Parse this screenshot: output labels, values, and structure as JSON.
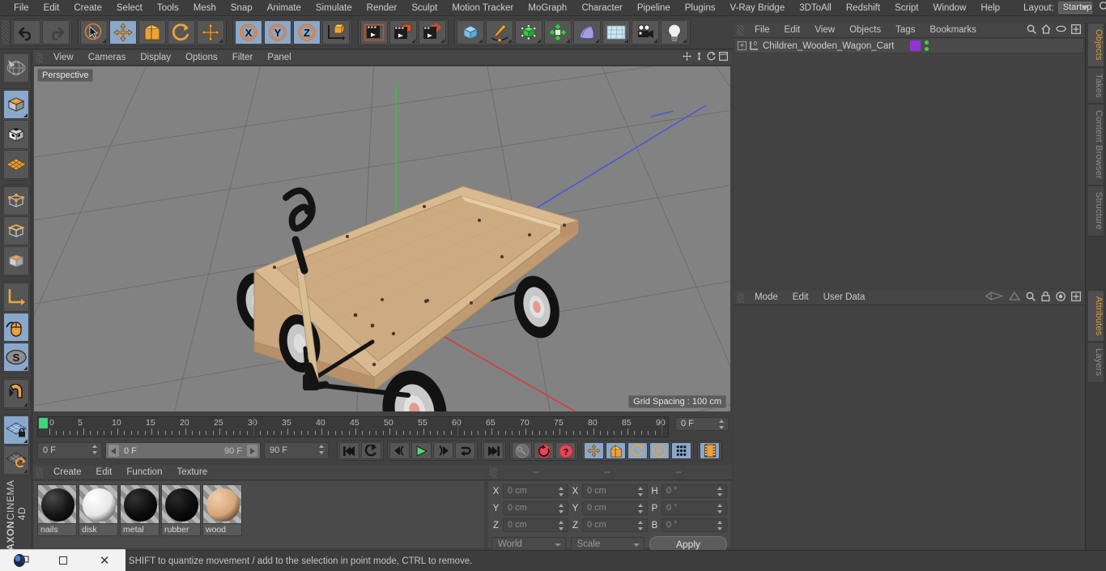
{
  "menubar": {
    "items": [
      "File",
      "Edit",
      "Create",
      "Select",
      "Tools",
      "Mesh",
      "Snap",
      "Animate",
      "Simulate",
      "Render",
      "Sculpt",
      "Motion Tracker",
      "MoGraph",
      "Character",
      "Pipeline",
      "Plugins",
      "V-Ray Bridge",
      "3DToAll",
      "Redshift",
      "Script",
      "Window",
      "Help"
    ],
    "layout_label": "Layout:",
    "layout_value": "Startup",
    "search_icon": "search-icon"
  },
  "toolbar": {
    "groups": [
      {
        "name": "undo-redo",
        "buttons": [
          {
            "name": "undo-button",
            "icon": "undo-arrow-icon",
            "active": false,
            "corner": false
          },
          {
            "name": "redo-button",
            "icon": "redo-arrow-icon",
            "active": false,
            "corner": false
          }
        ]
      },
      {
        "name": "transform-tools",
        "buttons": [
          {
            "name": "live-selection-tool",
            "icon": "cursor-circle-icon",
            "active": false,
            "corner": true
          },
          {
            "name": "move-tool",
            "icon": "move-arrows-icon",
            "active": true,
            "corner": false
          },
          {
            "name": "scale-tool",
            "icon": "scale-box-icon",
            "active": false,
            "corner": false
          },
          {
            "name": "rotate-tool",
            "icon": "rotate-circle-icon",
            "active": false,
            "corner": false
          },
          {
            "name": "dynamic-place-tool",
            "icon": "move-arrows-icon",
            "active": false,
            "corner": true
          }
        ]
      },
      {
        "name": "axis-locks",
        "buttons": [
          {
            "name": "lock-x-axis-button",
            "icon": "x-axis-icon",
            "active": true,
            "corner": false
          },
          {
            "name": "lock-y-axis-button",
            "icon": "y-axis-icon",
            "active": true,
            "corner": false
          },
          {
            "name": "lock-z-axis-button",
            "icon": "z-axis-icon",
            "active": true,
            "corner": false
          },
          {
            "name": "world-object-coord-button",
            "icon": "world-axis-cube-icon",
            "active": false,
            "corner": false
          }
        ]
      },
      {
        "name": "render-tools",
        "buttons": [
          {
            "name": "render-view-button",
            "icon": "clapperboard-icon",
            "active": false,
            "corner": false
          },
          {
            "name": "render-to-picture-viewer-button",
            "icon": "clapperboard-window-icon",
            "active": false,
            "corner": true
          },
          {
            "name": "render-settings-button",
            "icon": "clapperboard-gear-icon",
            "active": false,
            "corner": true
          }
        ]
      },
      {
        "name": "create-objects",
        "buttons": [
          {
            "name": "add-cube-button",
            "icon": "blue-cube-icon",
            "active": false,
            "corner": true
          },
          {
            "name": "add-spline-button",
            "icon": "pen-spline-icon",
            "active": false,
            "corner": true
          },
          {
            "name": "add-generator-button",
            "icon": "green-cube-icon",
            "active": false,
            "corner": true
          },
          {
            "name": "add-deformer-button",
            "icon": "green-explode-icon",
            "active": false,
            "corner": true
          },
          {
            "name": "add-scene-object-button",
            "icon": "purple-floor-icon",
            "active": false,
            "corner": true
          },
          {
            "name": "add-environment-button",
            "icon": "sky-grid-icon",
            "active": false,
            "corner": true
          },
          {
            "name": "add-camera-button",
            "icon": "camera-icon",
            "active": false,
            "corner": true
          },
          {
            "name": "add-light-button",
            "icon": "lightbulb-icon",
            "active": false,
            "corner": true
          }
        ]
      }
    ]
  },
  "left_toolbar": {
    "groups": [
      {
        "name": "sculpt-group",
        "buttons": [
          {
            "name": "make-editable-button",
            "icon": "globe-wireframe-icon",
            "active": false,
            "corner": false
          }
        ]
      },
      {
        "name": "mode-group",
        "buttons": [
          {
            "name": "model-mode-button",
            "icon": "orange-cube-icon",
            "active": true,
            "corner": true
          },
          {
            "name": "texture-mode-button",
            "icon": "checker-cube-icon",
            "active": false,
            "corner": false
          },
          {
            "name": "workplane-mode-button",
            "icon": "orange-grid-plane-icon",
            "active": false,
            "corner": false
          }
        ]
      },
      {
        "name": "component-group",
        "buttons": [
          {
            "name": "points-mode-button",
            "icon": "points-cube-icon",
            "active": false,
            "corner": false
          },
          {
            "name": "edges-mode-button",
            "icon": "edges-cube-icon",
            "active": false,
            "corner": false
          },
          {
            "name": "polygons-mode-button",
            "icon": "polygons-cube-icon",
            "active": false,
            "corner": false
          }
        ]
      },
      {
        "name": "axis-group",
        "buttons": [
          {
            "name": "enable-axis-button",
            "icon": "axis-l-icon",
            "active": false,
            "corner": false
          },
          {
            "name": "enable-snap-button",
            "icon": "mouse-curve-icon",
            "active": true,
            "corner": false
          },
          {
            "name": "soft-selection-button",
            "icon": "s-circle-icon",
            "active": true,
            "corner": true
          }
        ]
      },
      {
        "name": "magnet-group",
        "buttons": [
          {
            "name": "magnet-tool-button",
            "icon": "magnet-icon",
            "active": false,
            "corner": true
          }
        ]
      },
      {
        "name": "workplane-group",
        "buttons": [
          {
            "name": "lock-workplane-button",
            "icon": "grid-lock-icon",
            "active": true,
            "corner": true
          },
          {
            "name": "planar-workplane-button",
            "icon": "grid-rotate-icon",
            "active": false,
            "corner": true
          }
        ]
      }
    ],
    "brand_top": "MAXON",
    "brand_bottom": "CINEMA 4D"
  },
  "viewport": {
    "menu": [
      "View",
      "Cameras",
      "Display",
      "Options",
      "Filter",
      "Panel"
    ],
    "camera_label": "Perspective",
    "grid_spacing": "Grid Spacing : 100 cm",
    "axis_gizmo": {
      "x": "X",
      "y": "Y",
      "z": "Z",
      "x_color": "#d84a4a",
      "y_color": "#3dc93d",
      "z_color": "#4a6fd8"
    },
    "header_icons": [
      "pan-icon",
      "zoom-icon",
      "rotate-icon",
      "maximize-icon"
    ],
    "background_color": "#828282",
    "model": {
      "name": "children wooden wagon cart",
      "wood_color": "#d8b58c",
      "wheel_color": "#111111",
      "hub_color": "#e8a090"
    }
  },
  "timeline": {
    "ticks": [
      0,
      5,
      10,
      15,
      20,
      25,
      30,
      35,
      40,
      45,
      50,
      55,
      60,
      65,
      70,
      75,
      80,
      85,
      90
    ],
    "range_start": 0,
    "range_end": 90,
    "current_frame_field": "0 F",
    "start_field": "0 F",
    "range_left_label": "0 F",
    "range_right_label": "90 F",
    "end_field": "90 F",
    "controls": [
      {
        "name": "go-to-start-button",
        "icon": "skip-start-icon",
        "active": false
      },
      {
        "name": "go-to-previous-key-button",
        "icon": "prev-key-icon",
        "active": false
      },
      {
        "name": "go-to-previous-frame-button",
        "icon": "prev-frame-icon",
        "active": false
      },
      {
        "name": "play-button",
        "icon": "play-icon",
        "active": false
      },
      {
        "name": "go-to-next-frame-button",
        "icon": "next-frame-icon",
        "active": false
      },
      {
        "name": "loop-button",
        "icon": "loop-arrow-icon",
        "active": false
      },
      {
        "name": "go-to-end-button",
        "icon": "skip-end-icon",
        "active": false
      },
      {
        "name": "record-active-objects-button",
        "icon": "key-icon",
        "active": false
      },
      {
        "name": "autokeying-button",
        "icon": "autokey-circle-icon",
        "active": false
      },
      {
        "name": "keyframe-selection-button",
        "icon": "question-circle-icon",
        "active": false
      },
      {
        "name": "position-key-button",
        "icon": "move-arrows-icon",
        "active": true
      },
      {
        "name": "scale-key-button",
        "icon": "scale-box-icon",
        "active": true
      },
      {
        "name": "rotation-key-button",
        "icon": "rotate-circle-icon",
        "active": true
      },
      {
        "name": "param-key-button",
        "icon": "p-circle-icon",
        "active": true
      },
      {
        "name": "point-level-anim-button",
        "icon": "dots-grid-icon",
        "active": true
      },
      {
        "name": "timeline-toggle-button",
        "icon": "filmstrip-icon",
        "active": true
      }
    ]
  },
  "material_manager": {
    "menu": [
      "Create",
      "Edit",
      "Function",
      "Texture"
    ],
    "materials": [
      {
        "name": "nails",
        "color": "#141414",
        "highlight": "#4a4a4a"
      },
      {
        "name": "disk",
        "color": "#e6e6e6",
        "highlight": "#ffffff"
      },
      {
        "name": "metal",
        "color": "#0c0c0c",
        "highlight": "#333333"
      },
      {
        "name": "rubber",
        "color": "#0a0a0a",
        "highlight": "#2a2a2a"
      },
      {
        "name": "wood",
        "color": "#d6a579",
        "highlight": "#f0cfae"
      }
    ]
  },
  "coordinates": {
    "header_dashes": [
      "--",
      "--",
      "--"
    ],
    "rows": [
      {
        "pos_label": "X",
        "pos_value": "0 cm",
        "size_label": "X",
        "size_value": "0 cm",
        "rot_label": "H",
        "rot_value": "0 °"
      },
      {
        "pos_label": "Y",
        "pos_value": "0 cm",
        "size_label": "Y",
        "size_value": "0 cm",
        "rot_label": "P",
        "rot_value": "0 °"
      },
      {
        "pos_label": "Z",
        "pos_value": "0 cm",
        "size_label": "Z",
        "size_value": "0 cm",
        "rot_label": "B",
        "rot_value": "0 °"
      }
    ],
    "coord_system": "World",
    "size_mode": "Scale",
    "apply_label": "Apply"
  },
  "object_manager": {
    "menu": [
      "File",
      "Edit",
      "View",
      "Objects",
      "Tags",
      "Bookmarks"
    ],
    "header_icons": [
      "search-icon",
      "home-icon",
      "ellipse-icon",
      "plus-box-icon"
    ],
    "objects": [
      {
        "name": "Children_Wooden_Wagon_Cart",
        "icon": "null-object-icon",
        "layer_color": "#9333d6",
        "visibility_dots": 2
      }
    ]
  },
  "attributes": {
    "menu": [
      "Mode",
      "Edit",
      "User Data"
    ],
    "header_icons": [
      "back-nav-icon",
      "forward-nav-icon",
      "search-icon",
      "lock-icon",
      "target-icon",
      "plus-box-icon"
    ]
  },
  "right_tabs": {
    "top": [
      {
        "label": "Objects",
        "active": true
      },
      {
        "label": "Takes",
        "active": false
      },
      {
        "label": "Content Browser",
        "active": false
      },
      {
        "label": "Structure",
        "active": false
      }
    ],
    "bottom": [
      {
        "label": "Attributes",
        "active": true
      },
      {
        "label": "Layers",
        "active": false
      }
    ]
  },
  "statusbar": {
    "text": "Move elements. Hold down SHIFT to quantize movement / add to the selection in point mode, CTRL to remove."
  },
  "window_controls": {
    "app_icon": "app-logo-icon",
    "restore_icon": "restore-window-icon",
    "maximize_icon": "maximize-window-icon",
    "close_icon": "close-window-icon"
  }
}
